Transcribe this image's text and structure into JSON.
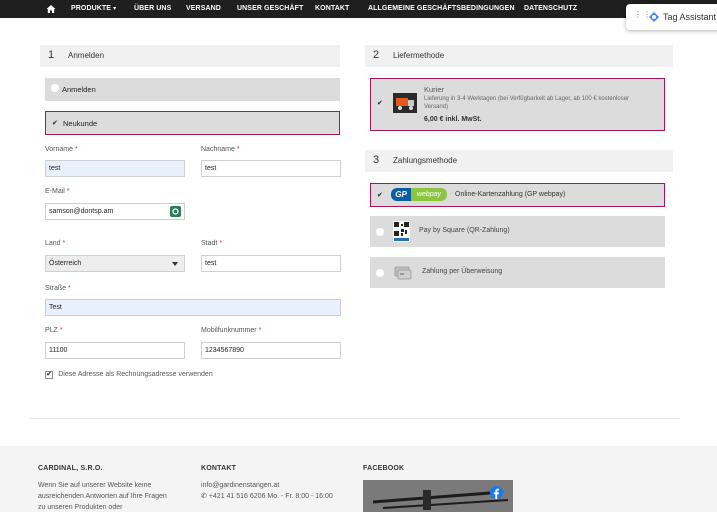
{
  "nav": {
    "items": [
      "PRODUKTE",
      "ÜBER UNS",
      "VERSAND",
      "UNSER GESCHÄFT",
      "KONTAKT",
      "ALLGEMEINE GESCHÄFTSBEDINGUNGEN",
      "DATENSCHUTZ"
    ],
    "home_icon": "home-icon",
    "products_caret_icon": "chevron-down-icon"
  },
  "tag_assistant": {
    "label": "Tag Assistant"
  },
  "login_section": {
    "number": "1",
    "title": "Anmelden",
    "options": [
      {
        "label": "Anmelden",
        "selected": false
      },
      {
        "label": "Neukunde",
        "selected": true
      }
    ]
  },
  "form": {
    "firstname": {
      "label": "Vorname",
      "value": "test"
    },
    "lastname": {
      "label": "Nachname",
      "value": "test"
    },
    "email": {
      "label": "E-Mail",
      "value": "samson@dontsp.am"
    },
    "country": {
      "label": "Land",
      "value": "Österreich"
    },
    "city": {
      "label": "Stadt",
      "value": "test"
    },
    "street": {
      "label": "Straße",
      "value": "Test"
    },
    "zip": {
      "label": "PLZ",
      "value": "11100"
    },
    "mobile": {
      "label": "Mobilfunknummer",
      "value": "1234567890"
    },
    "required_mark": "*",
    "billing_checkbox": {
      "label": "Diese Adresse als Rechnungsadresse verwenden",
      "checked": true
    }
  },
  "delivery_section": {
    "number": "2",
    "title": "Liefermethode",
    "option": {
      "name": "Kurier",
      "description": "Lieferung in 3-4 Werktagen (bei Verfügbarkeit ab Lager, ab 100 € kostenloser Versand)",
      "price": "6,00 € inkl. MwSt.",
      "selected": true
    }
  },
  "payment_section": {
    "number": "3",
    "title": "Zahlungsmethode",
    "options": [
      {
        "label": "Online-Kartenzahlung (GP webpay)",
        "logo_gp": "GP",
        "logo_webpay": "webpay",
        "selected": true
      },
      {
        "label": "Pay by Square (QR-Zahlung)",
        "selected": false
      },
      {
        "label": "Zahlung per Überweisung",
        "selected": false
      }
    ]
  },
  "footer": {
    "col1": {
      "heading": "CARDINAL, S.R.O.",
      "lines": [
        "Wenn Sie auf unserer Website keine",
        "ausreichenden Antworten auf Ihre Fragen",
        "zu unseren Produkten oder"
      ]
    },
    "col2": {
      "heading": "KONTAKT",
      "email": "info@gardinenstangen.at",
      "phone": "+421 41 516 6206 Mo. - Fr. 8:00 - 16:00"
    },
    "col3": {
      "heading": "FACEBOOK"
    }
  },
  "colors": {
    "nav_bg": "#1f1f1f",
    "accent": "#a3175a",
    "option_bg": "#dcdcdc",
    "autofill_bg": "#e8f0fe",
    "webpay_green": "#8cc63f",
    "gp_blue": "#0a5ea8",
    "facebook_blue": "#1877f2"
  }
}
